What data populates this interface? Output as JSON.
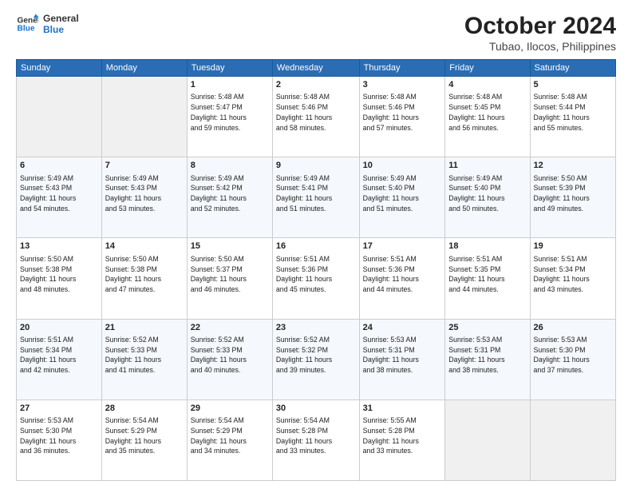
{
  "logo": {
    "line1": "General",
    "line2": "Blue",
    "icon_color": "#1a73c8"
  },
  "title": "October 2024",
  "subtitle": "Tubao, Ilocos, Philippines",
  "weekdays": [
    "Sunday",
    "Monday",
    "Tuesday",
    "Wednesday",
    "Thursday",
    "Friday",
    "Saturday"
  ],
  "weeks": [
    [
      {
        "day": "",
        "info": ""
      },
      {
        "day": "",
        "info": ""
      },
      {
        "day": "1",
        "info": "Sunrise: 5:48 AM\nSunset: 5:47 PM\nDaylight: 11 hours\nand 59 minutes."
      },
      {
        "day": "2",
        "info": "Sunrise: 5:48 AM\nSunset: 5:46 PM\nDaylight: 11 hours\nand 58 minutes."
      },
      {
        "day": "3",
        "info": "Sunrise: 5:48 AM\nSunset: 5:46 PM\nDaylight: 11 hours\nand 57 minutes."
      },
      {
        "day": "4",
        "info": "Sunrise: 5:48 AM\nSunset: 5:45 PM\nDaylight: 11 hours\nand 56 minutes."
      },
      {
        "day": "5",
        "info": "Sunrise: 5:48 AM\nSunset: 5:44 PM\nDaylight: 11 hours\nand 55 minutes."
      }
    ],
    [
      {
        "day": "6",
        "info": "Sunrise: 5:49 AM\nSunset: 5:43 PM\nDaylight: 11 hours\nand 54 minutes."
      },
      {
        "day": "7",
        "info": "Sunrise: 5:49 AM\nSunset: 5:43 PM\nDaylight: 11 hours\nand 53 minutes."
      },
      {
        "day": "8",
        "info": "Sunrise: 5:49 AM\nSunset: 5:42 PM\nDaylight: 11 hours\nand 52 minutes."
      },
      {
        "day": "9",
        "info": "Sunrise: 5:49 AM\nSunset: 5:41 PM\nDaylight: 11 hours\nand 51 minutes."
      },
      {
        "day": "10",
        "info": "Sunrise: 5:49 AM\nSunset: 5:40 PM\nDaylight: 11 hours\nand 51 minutes."
      },
      {
        "day": "11",
        "info": "Sunrise: 5:49 AM\nSunset: 5:40 PM\nDaylight: 11 hours\nand 50 minutes."
      },
      {
        "day": "12",
        "info": "Sunrise: 5:50 AM\nSunset: 5:39 PM\nDaylight: 11 hours\nand 49 minutes."
      }
    ],
    [
      {
        "day": "13",
        "info": "Sunrise: 5:50 AM\nSunset: 5:38 PM\nDaylight: 11 hours\nand 48 minutes."
      },
      {
        "day": "14",
        "info": "Sunrise: 5:50 AM\nSunset: 5:38 PM\nDaylight: 11 hours\nand 47 minutes."
      },
      {
        "day": "15",
        "info": "Sunrise: 5:50 AM\nSunset: 5:37 PM\nDaylight: 11 hours\nand 46 minutes."
      },
      {
        "day": "16",
        "info": "Sunrise: 5:51 AM\nSunset: 5:36 PM\nDaylight: 11 hours\nand 45 minutes."
      },
      {
        "day": "17",
        "info": "Sunrise: 5:51 AM\nSunset: 5:36 PM\nDaylight: 11 hours\nand 44 minutes."
      },
      {
        "day": "18",
        "info": "Sunrise: 5:51 AM\nSunset: 5:35 PM\nDaylight: 11 hours\nand 44 minutes."
      },
      {
        "day": "19",
        "info": "Sunrise: 5:51 AM\nSunset: 5:34 PM\nDaylight: 11 hours\nand 43 minutes."
      }
    ],
    [
      {
        "day": "20",
        "info": "Sunrise: 5:51 AM\nSunset: 5:34 PM\nDaylight: 11 hours\nand 42 minutes."
      },
      {
        "day": "21",
        "info": "Sunrise: 5:52 AM\nSunset: 5:33 PM\nDaylight: 11 hours\nand 41 minutes."
      },
      {
        "day": "22",
        "info": "Sunrise: 5:52 AM\nSunset: 5:33 PM\nDaylight: 11 hours\nand 40 minutes."
      },
      {
        "day": "23",
        "info": "Sunrise: 5:52 AM\nSunset: 5:32 PM\nDaylight: 11 hours\nand 39 minutes."
      },
      {
        "day": "24",
        "info": "Sunrise: 5:53 AM\nSunset: 5:31 PM\nDaylight: 11 hours\nand 38 minutes."
      },
      {
        "day": "25",
        "info": "Sunrise: 5:53 AM\nSunset: 5:31 PM\nDaylight: 11 hours\nand 38 minutes."
      },
      {
        "day": "26",
        "info": "Sunrise: 5:53 AM\nSunset: 5:30 PM\nDaylight: 11 hours\nand 37 minutes."
      }
    ],
    [
      {
        "day": "27",
        "info": "Sunrise: 5:53 AM\nSunset: 5:30 PM\nDaylight: 11 hours\nand 36 minutes."
      },
      {
        "day": "28",
        "info": "Sunrise: 5:54 AM\nSunset: 5:29 PM\nDaylight: 11 hours\nand 35 minutes."
      },
      {
        "day": "29",
        "info": "Sunrise: 5:54 AM\nSunset: 5:29 PM\nDaylight: 11 hours\nand 34 minutes."
      },
      {
        "day": "30",
        "info": "Sunrise: 5:54 AM\nSunset: 5:28 PM\nDaylight: 11 hours\nand 33 minutes."
      },
      {
        "day": "31",
        "info": "Sunrise: 5:55 AM\nSunset: 5:28 PM\nDaylight: 11 hours\nand 33 minutes."
      },
      {
        "day": "",
        "info": ""
      },
      {
        "day": "",
        "info": ""
      }
    ]
  ]
}
